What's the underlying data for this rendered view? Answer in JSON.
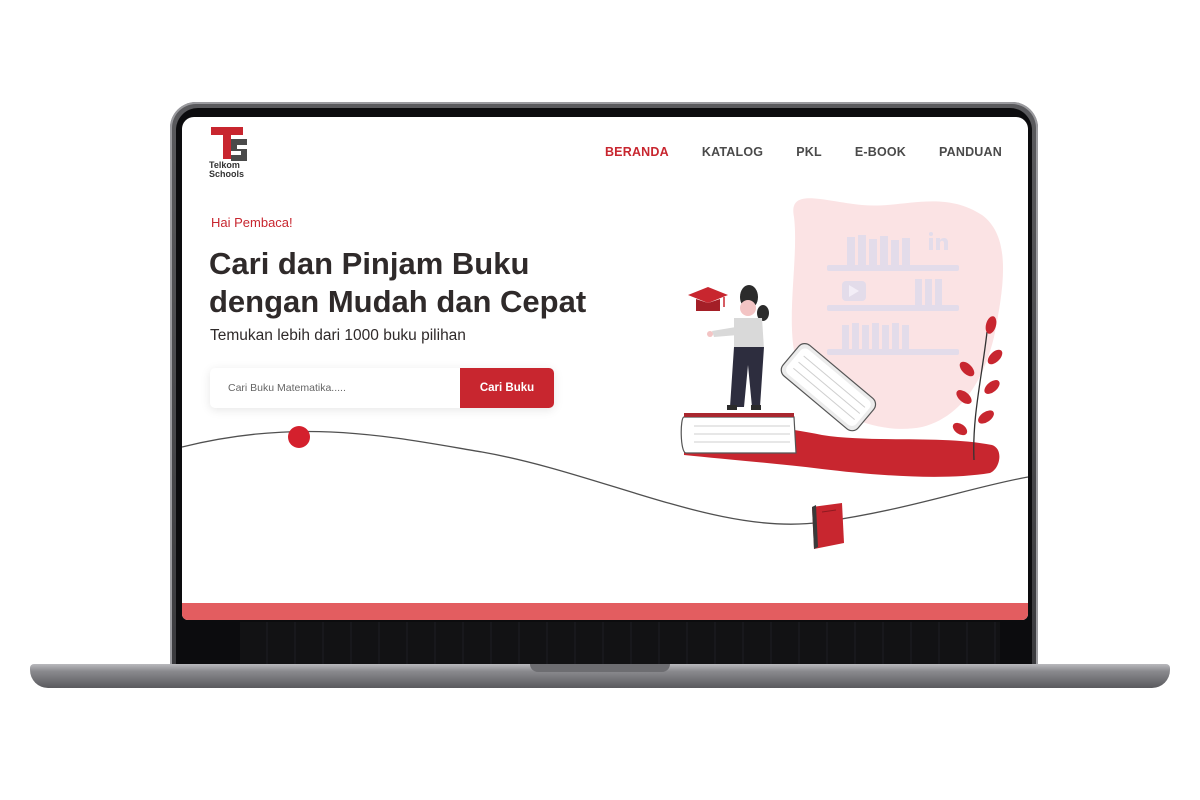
{
  "brand": {
    "logo_line1": "Telkom",
    "logo_line2": "Schools",
    "primary_color": "#c8262f",
    "footer_color": "#e35d60"
  },
  "nav": {
    "items": [
      {
        "label": "BERANDA",
        "active": true
      },
      {
        "label": "KATALOG",
        "active": false
      },
      {
        "label": "PKL",
        "active": false
      },
      {
        "label": "E-BOOK",
        "active": false
      },
      {
        "label": "PANDUAN",
        "active": false
      }
    ]
  },
  "hero": {
    "greeting": "Hai Pembaca!",
    "headline_line1": "Cari dan Pinjam Buku",
    "headline_line2": "dengan Mudah dan Cepat",
    "subheadline": "Temukan lebih dari 1000 buku pilihan"
  },
  "search": {
    "placeholder": "Cari Buku Matematika.....",
    "button_label": "Cari Buku"
  },
  "icons": {
    "graduation_cap": "graduation-cap-icon",
    "linkedin": "linkedin-icon",
    "youtube": "play-icon",
    "book": "book-icon"
  }
}
